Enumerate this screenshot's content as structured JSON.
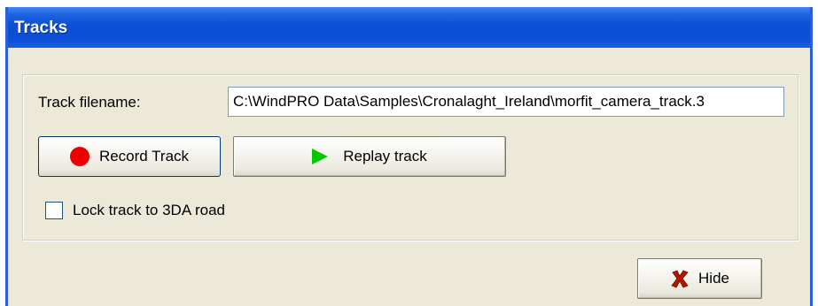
{
  "window": {
    "title": "Tracks"
  },
  "form": {
    "filename_label": "Track filename:",
    "filename_value": "C:\\WindPRO Data\\Samples\\Cronalaght_Ireland\\morfit_camera_track.3"
  },
  "buttons": {
    "record_label": "Record Track",
    "replay_label": "Replay track",
    "hide_label": "Hide"
  },
  "options": {
    "lock_label": "Lock track to 3DA road",
    "lock_checked": false
  },
  "icons": {
    "record": "record-icon",
    "replay": "play-icon",
    "hide": "close-x-icon"
  },
  "colors": {
    "title_bar": "#0a4fd6",
    "window_bg": "#ece9d8",
    "record_dot": "#ee0000",
    "play_triangle": "#00c800",
    "hide_x": "#b01800"
  }
}
